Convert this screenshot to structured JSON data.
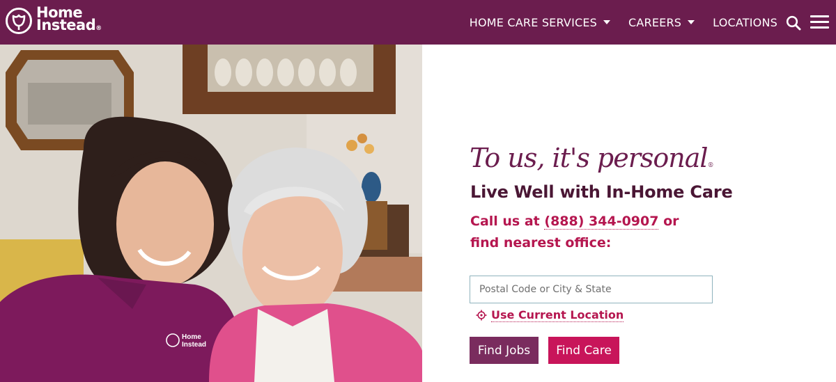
{
  "brand": {
    "line1": "Home",
    "line2": "Instead",
    "registered": "®",
    "shirt_logo_line1": "Home",
    "shirt_logo_line2": "Instead"
  },
  "nav": {
    "items": [
      {
        "label": "HOME CARE SERVICES",
        "has_dropdown": true
      },
      {
        "label": "CAREERS",
        "has_dropdown": true
      },
      {
        "label": "LOCATIONS",
        "has_dropdown": false
      }
    ],
    "search_icon": "search-icon",
    "menu_icon": "hamburger-menu-icon"
  },
  "hero": {
    "tagline": "To us, it's personal",
    "tagline_mark": "®",
    "headline": "Live Well with In-Home Care",
    "call_prefix": "Call us at",
    "phone": "(888) 344-0907",
    "call_suffix": "or find nearest office:"
  },
  "search": {
    "placeholder": "Postal Code or City & State",
    "value": ""
  },
  "location": {
    "label": "Use Current Location",
    "icon": "crosshair-icon"
  },
  "buttons": {
    "find_jobs": "Find Jobs",
    "find_care": "Find Care"
  },
  "colors": {
    "nav_bg": "#6b1d4e",
    "headline": "#4a1634",
    "accent": "#b5164f",
    "find_jobs_bg": "#7a2c5e",
    "find_care_bg": "#c8155a",
    "input_border": "#8fb3bd"
  }
}
